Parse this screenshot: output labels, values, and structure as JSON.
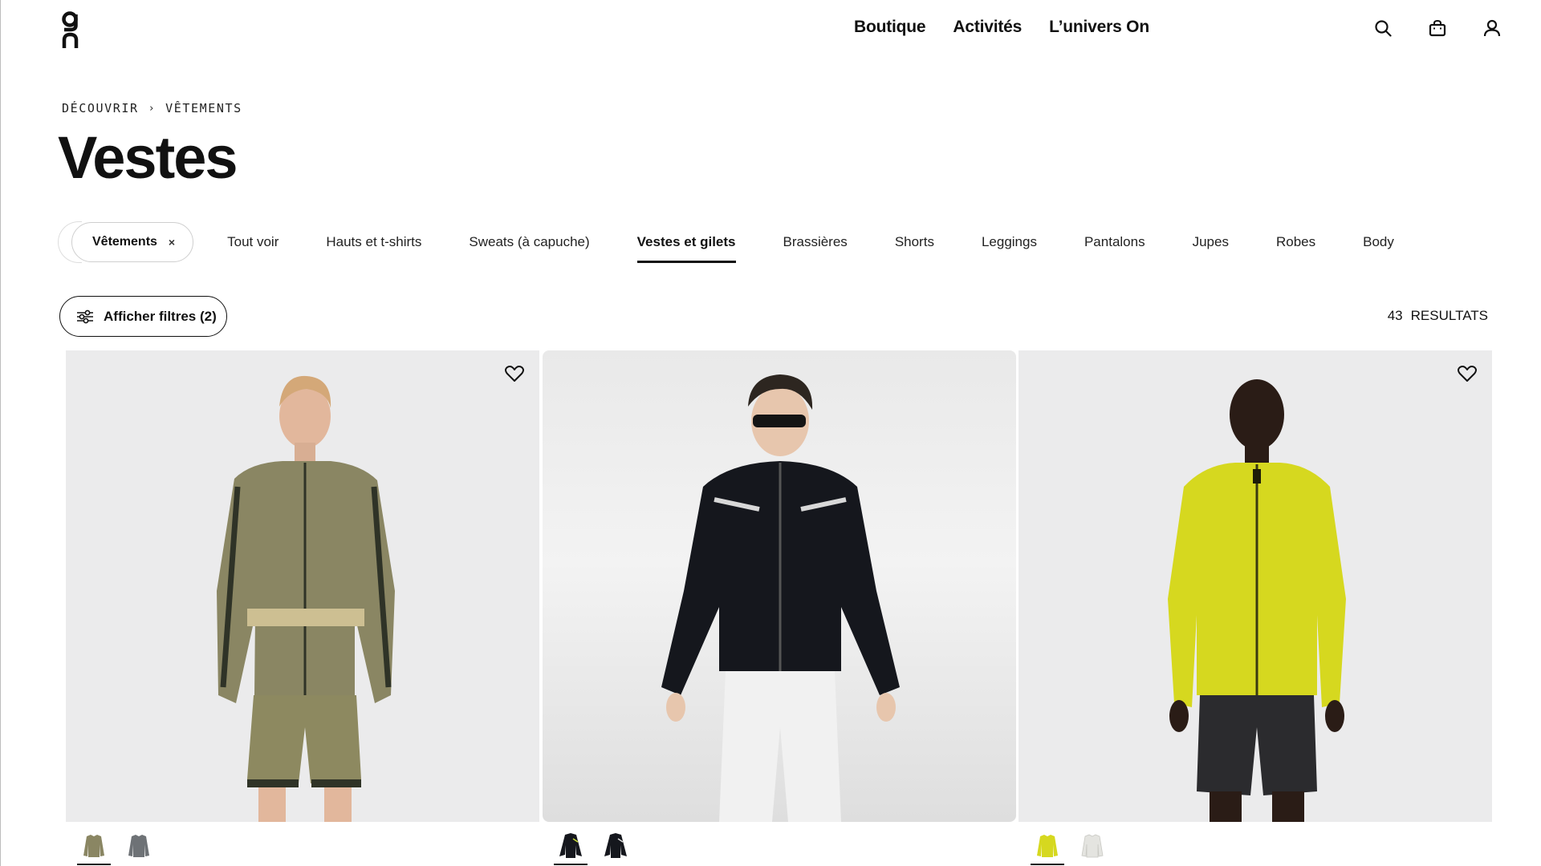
{
  "brand": {
    "logo_icon": "on-logo-icon"
  },
  "nav": {
    "items": [
      "Boutique",
      "Activités",
      "L’univers On"
    ]
  },
  "header_icons": [
    "search-icon",
    "bag-icon",
    "account-icon"
  ],
  "breadcrumb": {
    "items": [
      "DÉCOUVRIR",
      "VÊTEMENTS"
    ],
    "separator": "›"
  },
  "page": {
    "title": "Vestes"
  },
  "categories": {
    "chip_label": "Vêtements",
    "chip_close": "×",
    "tabs": [
      "Tout voir",
      "Hauts et t-shirts",
      "Sweats (à capuche)",
      "Vestes et gilets",
      "Brassières",
      "Shorts",
      "Leggings",
      "Pantalons",
      "Jupes",
      "Robes",
      "Body"
    ],
    "active_tab": "Vestes et gilets"
  },
  "filters": {
    "label": "Afficher filtres (2)"
  },
  "results": {
    "count": "43",
    "label": "RESULTATS"
  },
  "products": [
    {
      "color": "#8a8663",
      "swatch_colors": [
        "#8a8663",
        "#6e7276"
      ],
      "active_swatch": 0,
      "favorite": true
    },
    {
      "color": "#15171d",
      "swatch_colors": [
        "#15171d",
        "#15171d"
      ],
      "active_swatch": 0,
      "favorite": false
    },
    {
      "color": "#d6d81f",
      "swatch_colors": [
        "#d6d81f",
        "#e4e4e0"
      ],
      "active_swatch": 0,
      "favorite": true
    }
  ]
}
